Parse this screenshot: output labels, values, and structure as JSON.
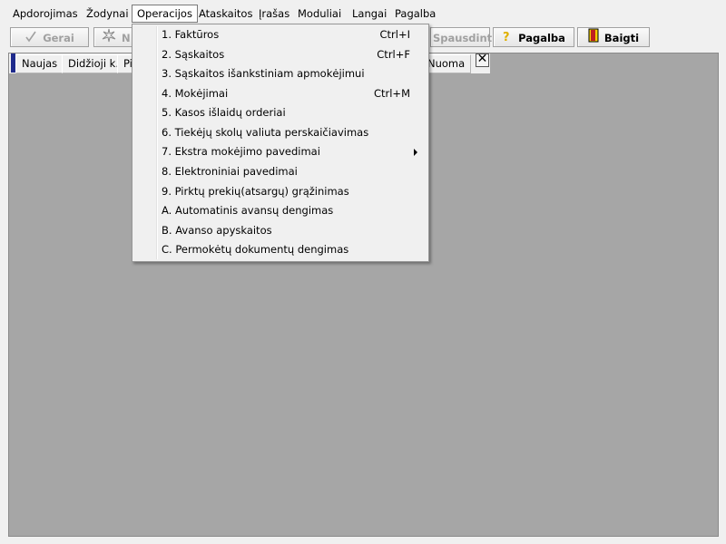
{
  "menubar": {
    "items": [
      {
        "label": "Apdorojimas"
      },
      {
        "label": "Žodynai"
      },
      {
        "label": "Operacijos"
      },
      {
        "label": "Ataskaitos"
      },
      {
        "label": "Įrašas"
      },
      {
        "label": "Moduliai"
      },
      {
        "label": "Langai"
      },
      {
        "label": "Pagalba"
      }
    ]
  },
  "toolbar": {
    "ok_label": "Gerai",
    "new_label": "N",
    "print_label": "Spausdinti",
    "help_label": "Pagalba",
    "exit_label": "Baigti"
  },
  "tabs": {
    "items": [
      "Naujas",
      "Didžioji k.",
      "Pi",
      "Nuoma"
    ],
    "close_glyph": "✕"
  },
  "operations_menu": {
    "items": [
      {
        "label": "1. Faktūros",
        "shortcut": "Ctrl+I"
      },
      {
        "label": "2. Sąskaitos",
        "shortcut": "Ctrl+F"
      },
      {
        "label": "3. Sąskaitos išankstiniam apmokėjimui",
        "shortcut": ""
      },
      {
        "label": "4. Mokėjimai",
        "shortcut": "Ctrl+M"
      },
      {
        "label": "5. Kasos išlaidų orderiai",
        "shortcut": ""
      },
      {
        "label": "6. Tiekėjų skolų valiuta perskaičiavimas",
        "shortcut": ""
      },
      {
        "label": "7. Ekstra mokėjimo pavedimai",
        "shortcut": ""
      },
      {
        "label": "8. Elektroniniai pavedimai",
        "shortcut": ""
      },
      {
        "label": "9. Pirktų prekių(atsargų) grąžinimas",
        "shortcut": ""
      },
      {
        "label": "A. Automatinis avansų dengimas",
        "shortcut": ""
      },
      {
        "label": "B. Avanso apyskaitos",
        "shortcut": ""
      },
      {
        "label": "C. Permokėtų dokumentų dengimas",
        "shortcut": ""
      }
    ]
  },
  "colors": {
    "workspace": "#a6a6a6",
    "tab_marker": "#1e2a8c",
    "help_icon": "#e0b000",
    "exit_icon": "#f5d000"
  }
}
